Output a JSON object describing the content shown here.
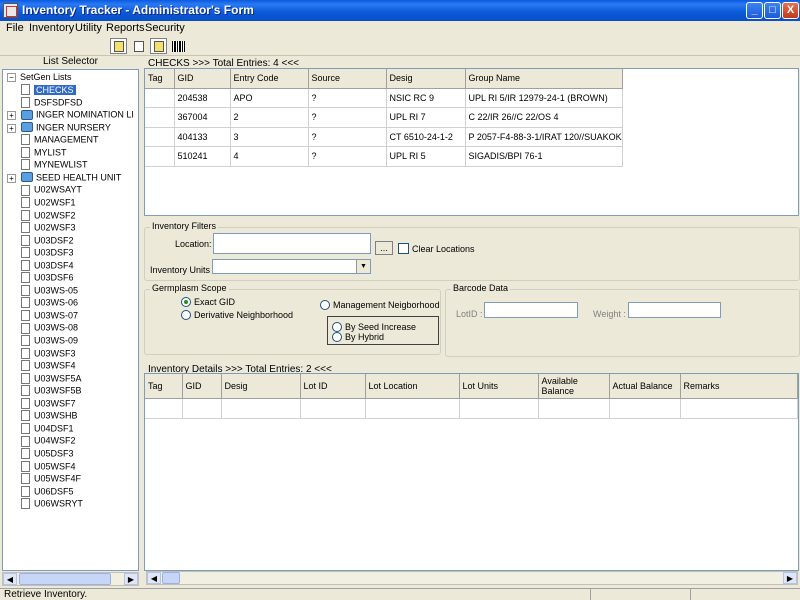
{
  "window": {
    "title": "Inventory Tracker - Administrator's Form",
    "minimize_glyph": "_",
    "maximize_glyph": "□",
    "close_glyph": "X"
  },
  "menu": [
    "File",
    "Inventory",
    "Utility",
    "Reports",
    "Security"
  ],
  "left_panel": {
    "header": "List Selector",
    "root_label": "SetGen Lists",
    "root_expander": "−",
    "items": [
      {
        "label": "CHECKS",
        "icon": "file-icon",
        "selected": true,
        "expandable": false
      },
      {
        "label": "DSFSDFSD",
        "icon": "file-icon",
        "selected": false,
        "expandable": false
      },
      {
        "label": "INGER NOMINATION LI",
        "icon": "folder-icon",
        "selected": false,
        "expandable": true
      },
      {
        "label": "INGER NURSERY",
        "icon": "folder-icon",
        "selected": false,
        "expandable": true
      },
      {
        "label": "MANAGEMENT",
        "icon": "file-icon",
        "selected": false,
        "expandable": false
      },
      {
        "label": "MYLIST",
        "icon": "file-icon",
        "selected": false,
        "expandable": false
      },
      {
        "label": "MYNEWLIST",
        "icon": "file-icon",
        "selected": false,
        "expandable": false
      },
      {
        "label": "SEED HEALTH UNIT",
        "icon": "folder-icon",
        "selected": false,
        "expandable": true
      },
      {
        "label": "U02WSAYT",
        "icon": "file-icon",
        "selected": false,
        "expandable": false
      },
      {
        "label": "U02WSF1",
        "icon": "file-icon",
        "selected": false,
        "expandable": false
      },
      {
        "label": "U02WSF2",
        "icon": "file-icon",
        "selected": false,
        "expandable": false
      },
      {
        "label": "U02WSF3",
        "icon": "file-icon",
        "selected": false,
        "expandable": false
      },
      {
        "label": "U03DSF2",
        "icon": "file-icon",
        "selected": false,
        "expandable": false
      },
      {
        "label": "U03DSF3",
        "icon": "file-icon",
        "selected": false,
        "expandable": false
      },
      {
        "label": "U03DSF4",
        "icon": "file-icon",
        "selected": false,
        "expandable": false
      },
      {
        "label": "U03DSF6",
        "icon": "file-icon",
        "selected": false,
        "expandable": false
      },
      {
        "label": "U03WS-05",
        "icon": "file-icon",
        "selected": false,
        "expandable": false
      },
      {
        "label": "U03WS-06",
        "icon": "file-icon",
        "selected": false,
        "expandable": false
      },
      {
        "label": "U03WS-07",
        "icon": "file-icon",
        "selected": false,
        "expandable": false
      },
      {
        "label": "U03WS-08",
        "icon": "file-icon",
        "selected": false,
        "expandable": false
      },
      {
        "label": "U03WS-09",
        "icon": "file-icon",
        "selected": false,
        "expandable": false
      },
      {
        "label": "U03WSF3",
        "icon": "file-icon",
        "selected": false,
        "expandable": false
      },
      {
        "label": "U03WSF4",
        "icon": "file-icon",
        "selected": false,
        "expandable": false
      },
      {
        "label": "U03WSF5A",
        "icon": "file-icon",
        "selected": false,
        "expandable": false
      },
      {
        "label": "U03WSF5B",
        "icon": "file-icon",
        "selected": false,
        "expandable": false
      },
      {
        "label": "U03WSF7",
        "icon": "file-icon",
        "selected": false,
        "expandable": false
      },
      {
        "label": "U03WSHB",
        "icon": "file-icon",
        "selected": false,
        "expandable": false
      },
      {
        "label": "U04DSF1",
        "icon": "file-icon",
        "selected": false,
        "expandable": false
      },
      {
        "label": "U04WSF2",
        "icon": "file-icon",
        "selected": false,
        "expandable": false
      },
      {
        "label": "U05DSF3",
        "icon": "file-icon",
        "selected": false,
        "expandable": false
      },
      {
        "label": "U05WSF4",
        "icon": "file-icon",
        "selected": false,
        "expandable": false
      },
      {
        "label": "U05WSF4F",
        "icon": "file-icon",
        "selected": false,
        "expandable": false
      },
      {
        "label": "U06DSF5",
        "icon": "file-icon",
        "selected": false,
        "expandable": false
      },
      {
        "label": "U06WSRYT",
        "icon": "file-icon",
        "selected": false,
        "expandable": false
      }
    ]
  },
  "checks": {
    "label": "CHECKS >>> Total Entries: 4 <<<",
    "columns": [
      "Tag",
      "GID",
      "Entry Code",
      "Source",
      "Desig",
      "Group Name"
    ],
    "rows": [
      [
        "",
        "204538",
        "APO",
        "?",
        "NSIC RC 9",
        "UPL RI 5/IR 12979-24-1 (BROWN)"
      ],
      [
        "",
        "367004",
        "2",
        "?",
        "UPL RI 7",
        "C 22/IR 26//C 22/OS 4"
      ],
      [
        "",
        "404133",
        "3",
        "?",
        "CT 6510-24-1-2",
        "P 2057-F4-88-3-1/IRAT 120//SUAKOKO///"
      ],
      [
        "",
        "510241",
        "4",
        "?",
        "UPL RI 5",
        "SIGADIS/BPI 76-1"
      ]
    ]
  },
  "filters": {
    "title": "Inventory Filters",
    "location_label": "Location:",
    "location_value": "",
    "browse_label": "...",
    "clear_locations_label": "Clear Locations",
    "clear_locations_checked": false,
    "units_label": "Inventory Units :",
    "units_value": ""
  },
  "germplasm": {
    "title": "Germplasm Scope",
    "options": {
      "exact_gid": {
        "label": "Exact GID",
        "checked": true
      },
      "derivative": {
        "label": "Derivative Neighborhood",
        "checked": false
      },
      "management": {
        "label": "Management Neigborhood",
        "checked": false
      },
      "seed_increase": {
        "label": "By Seed Increase",
        "checked": false
      },
      "hybrid": {
        "label": "By Hybrid",
        "checked": false
      }
    }
  },
  "barcode": {
    "title": "Barcode Data",
    "lotid_label": "LotID :",
    "lotid_value": "",
    "weight_label": "Weight :",
    "weight_value": ""
  },
  "details": {
    "label": "Inventory Details >>> Total Entries: 2 <<<",
    "columns": [
      "Tag",
      "GID",
      "Desig",
      "Lot ID",
      "Lot Location",
      "Lot Units",
      "Available Balance",
      "Actual Balance",
      "Remarks"
    ],
    "rows": [
      [
        "",
        "",
        "",
        "",
        "",
        "",
        "",
        "",
        ""
      ]
    ]
  },
  "scroll": {
    "left_arrow": "◀",
    "right_arrow": "▶"
  },
  "status": {
    "text": "Retrieve Inventory."
  }
}
